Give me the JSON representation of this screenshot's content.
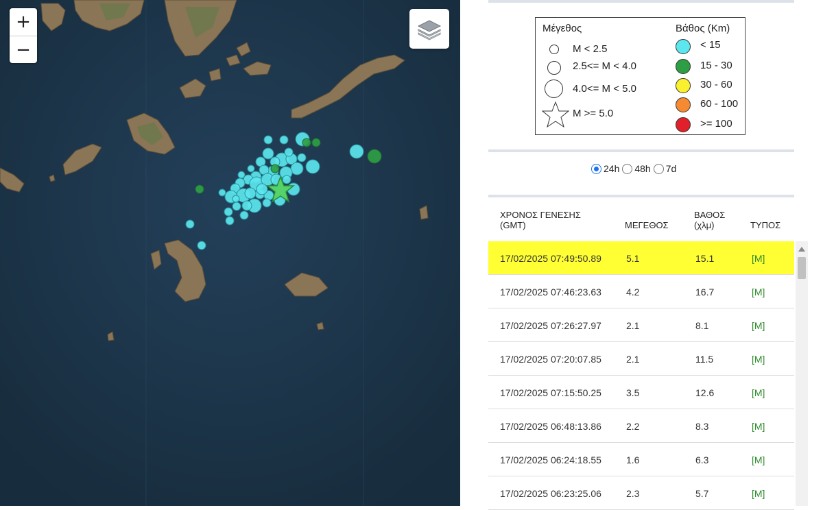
{
  "map": {
    "zoom_in_label": "+",
    "zoom_out_label": "−",
    "layers_icon": "layers-icon"
  },
  "legend": {
    "magnitude_title": "Μέγεθος",
    "depth_title": "Βάθος (Km)",
    "magnitude_items": [
      "M < 2.5",
      "2.5<= M < 4.0",
      "4.0<= M < 5.0",
      "M >= 5.0"
    ],
    "depth_items": [
      {
        "label": "< 15",
        "color": "#5ce6ee"
      },
      {
        "label": "15 - 30",
        "color": "#2e9e45"
      },
      {
        "label": "30 - 60",
        "color": "#fbf02e"
      },
      {
        "label": "60 - 100",
        "color": "#f58a32"
      },
      {
        "label": ">= 100",
        "color": "#e0202a"
      }
    ]
  },
  "time_filter": {
    "options": [
      "24h",
      "48h",
      "7d"
    ],
    "selected": "24h"
  },
  "table": {
    "headers": {
      "time_line1": "ΧΡΟΝΟΣ ΓΕΝΕΣΗΣ",
      "time_line2": "(GMT)",
      "magnitude": "ΜΕΓΕΘΟΣ",
      "depth_line1": "ΒΑΘΟΣ",
      "depth_line2": "(χλμ)",
      "type": "ΤΥΠΟΣ"
    },
    "rows": [
      {
        "time": "17/02/2025 07:49:50.89",
        "mag": "5.1",
        "depth": "15.1",
        "type": "[M]"
      },
      {
        "time": "17/02/2025 07:46:23.63",
        "mag": "4.2",
        "depth": "16.7",
        "type": "[M]"
      },
      {
        "time": "17/02/2025 07:26:27.97",
        "mag": "2.1",
        "depth": "8.1",
        "type": "[M]"
      },
      {
        "time": "17/02/2025 07:20:07.85",
        "mag": "2.1",
        "depth": "11.5",
        "type": "[M]"
      },
      {
        "time": "17/02/2025 07:15:50.25",
        "mag": "3.5",
        "depth": "12.6",
        "type": "[M]"
      },
      {
        "time": "17/02/2025 06:48:13.86",
        "mag": "2.2",
        "depth": "8.3",
        "type": "[M]"
      },
      {
        "time": "17/02/2025 06:24:18.55",
        "mag": "1.6",
        "depth": "6.3",
        "type": "[M]"
      },
      {
        "time": "17/02/2025 06:23:25.06",
        "mag": "2.3",
        "depth": "5.7",
        "type": "[M]"
      }
    ]
  }
}
